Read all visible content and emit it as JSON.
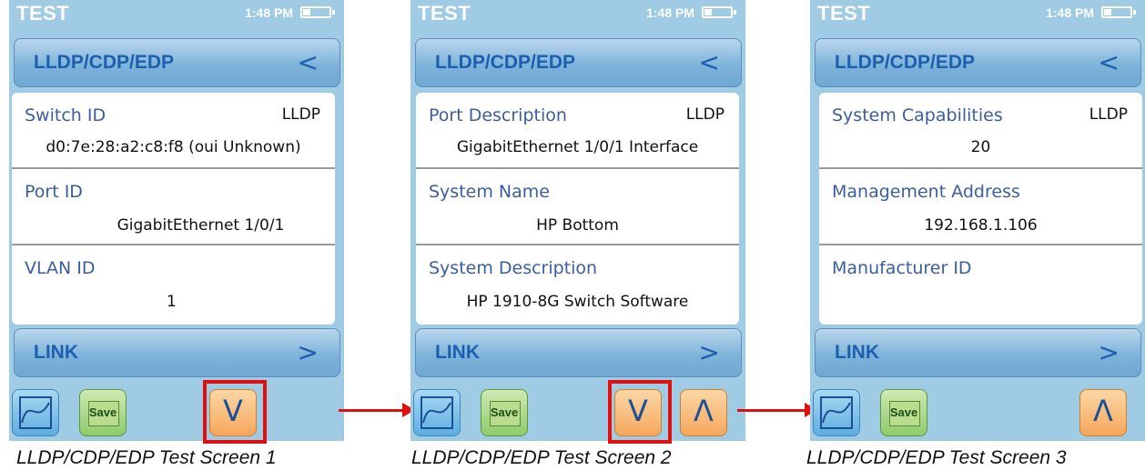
{
  "screens": [
    {
      "title": "TEST",
      "time": "1:48 PM",
      "header": {
        "label": "LLDP/CDP/EDP",
        "back_icon": "<"
      },
      "fields": [
        {
          "name": "Switch ID",
          "protocol": "LLDP",
          "value": "d0:7e:28:a2:c8:f8 (oui Unknown)"
        },
        {
          "name": "Port ID",
          "protocol": "",
          "value": "GigabitEthernet 1/0/1"
        },
        {
          "name": "VLAN ID",
          "protocol": "",
          "value": "1"
        }
      ],
      "link": {
        "label": "LINK",
        "icon": ">"
      },
      "save_label": "Save",
      "down_icon": "V",
      "caption": "LLDP/CDP/EDP Test Screen 1"
    },
    {
      "title": "TEST",
      "time": "1:48 PM",
      "header": {
        "label": "LLDP/CDP/EDP",
        "back_icon": "<"
      },
      "fields": [
        {
          "name": "Port Description",
          "protocol": "LLDP",
          "value": "GigabitEthernet 1/0/1 Interface"
        },
        {
          "name": "System Name",
          "protocol": "",
          "value": "HP Bottom"
        },
        {
          "name": "System Description",
          "protocol": "",
          "value": "HP 1910-8G Switch Software"
        }
      ],
      "link": {
        "label": "LINK",
        "icon": ">"
      },
      "save_label": "Save",
      "down_icon": "V",
      "up_icon": "Λ",
      "caption": "LLDP/CDP/EDP Test Screen 2"
    },
    {
      "title": "TEST",
      "time": "1:48 PM",
      "header": {
        "label": "LLDP/CDP/EDP",
        "back_icon": "<"
      },
      "fields": [
        {
          "name": "System Capabilities",
          "protocol": "LLDP",
          "value": "20"
        },
        {
          "name": "Management Address",
          "protocol": "",
          "value": "192.168.1.106"
        },
        {
          "name": "Manufacturer ID",
          "protocol": "",
          "value": ""
        }
      ],
      "link": {
        "label": "LINK",
        "icon": ">"
      },
      "save_label": "Save",
      "up_icon": "Λ",
      "caption": "LLDP/CDP/EDP Test Screen 3"
    }
  ],
  "colors": {
    "accent": "#1b5fae",
    "highlight": "#e11010",
    "screen_bg": "#9fcbe5"
  }
}
